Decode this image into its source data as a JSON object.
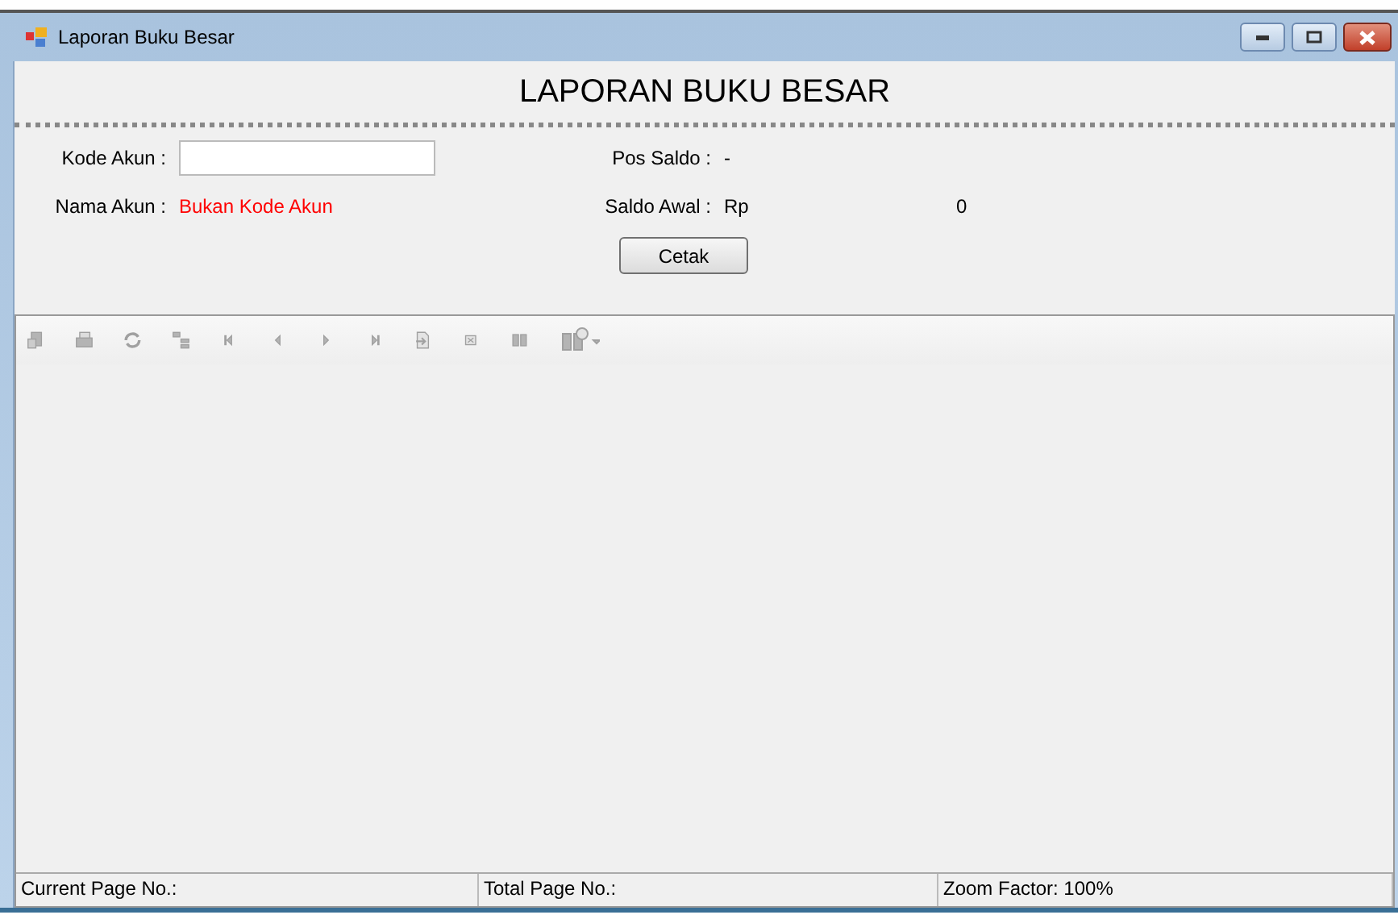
{
  "window": {
    "title": "Laporan Buku Besar"
  },
  "header": {
    "title": "LAPORAN BUKU BESAR"
  },
  "form": {
    "kode_akun": {
      "label": "Kode Akun :"
    },
    "nama_akun": {
      "label": "Nama Akun :",
      "value": "Bukan Kode Akun"
    },
    "pos_saldo": {
      "label": "Pos Saldo :",
      "value": "-"
    },
    "saldo_awal": {
      "label": "Saldo Awal :",
      "currency": "Rp",
      "amount": "0"
    },
    "button": "Cetak"
  },
  "status_bar": [
    "Current Page No.:",
    "Total Page No.:",
    "Zoom Factor: 100%"
  ]
}
